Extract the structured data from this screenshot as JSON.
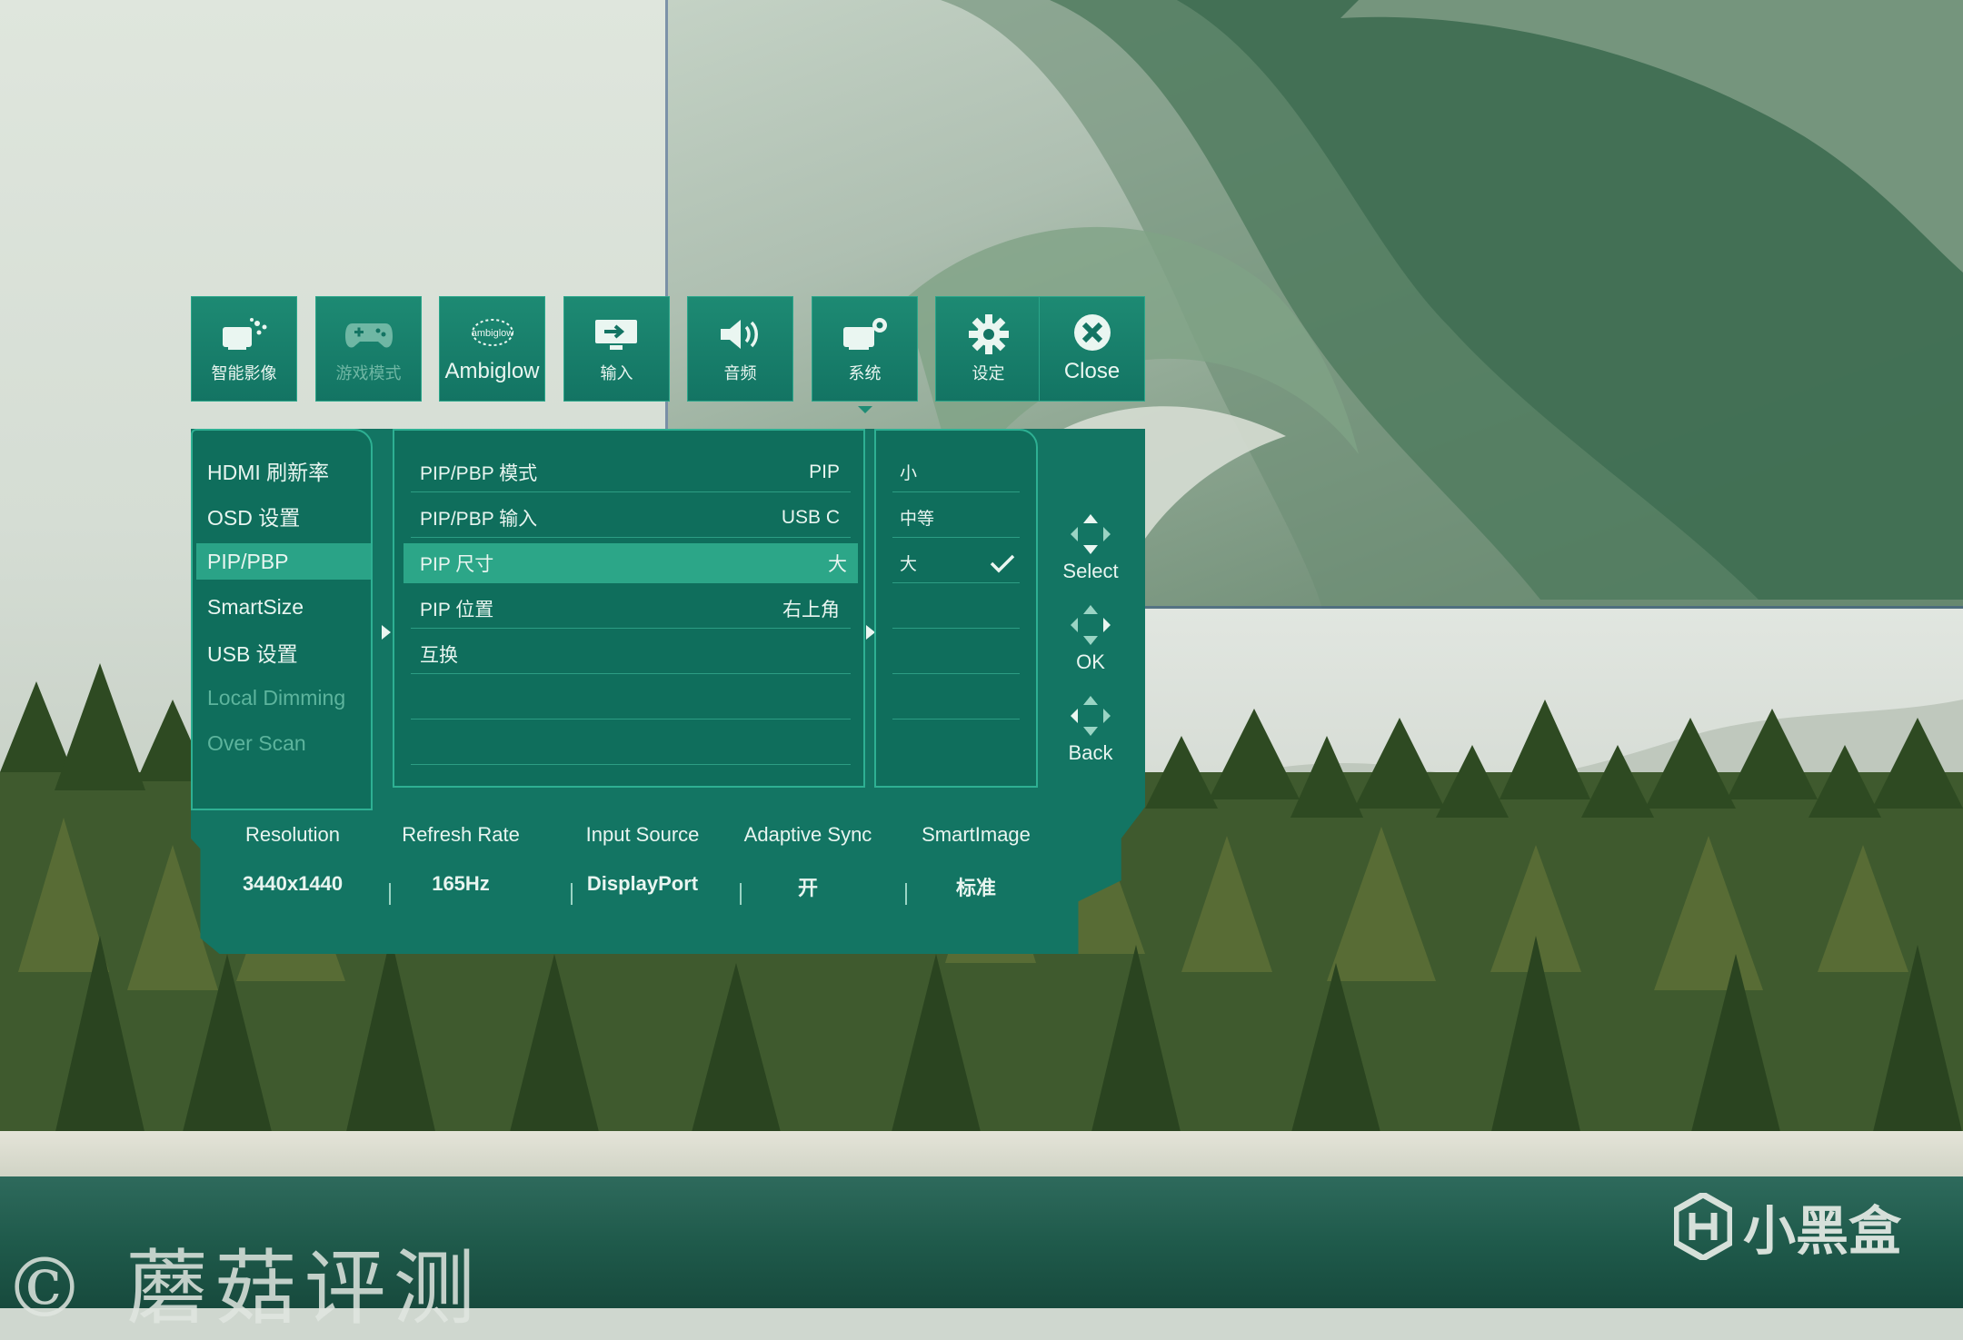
{
  "watermark": {
    "left_text": "© 蘑菇评测",
    "brand_text": "小黑盒"
  },
  "osd": {
    "tabs": [
      {
        "label": "智能影像",
        "icon": "smart-image-icon",
        "dim": false
      },
      {
        "label": "游戏模式",
        "icon": "gamepad-icon",
        "dim": true
      },
      {
        "label": "Ambiglow",
        "icon": "ambiglow-logo-icon",
        "dim": false
      },
      {
        "label": "输入",
        "icon": "input-icon",
        "dim": false
      },
      {
        "label": "音频",
        "icon": "speaker-icon",
        "dim": false
      },
      {
        "label": "系统",
        "icon": "system-icon",
        "dim": false
      },
      {
        "label": "设定",
        "icon": "gear-icon",
        "dim": false
      },
      {
        "label": "Close",
        "icon": "close-icon",
        "dim": false
      }
    ],
    "ambiglow_small": "ambiglow",
    "active_tab_index": 5,
    "left_menu": [
      {
        "label": "HDMI 刷新率",
        "state": "normal"
      },
      {
        "label": "OSD 设置",
        "state": "normal"
      },
      {
        "label": "PIP/PBP",
        "state": "selected"
      },
      {
        "label": "SmartSize",
        "state": "normal"
      },
      {
        "label": "USB 设置",
        "state": "normal"
      },
      {
        "label": "Local Dimming",
        "state": "dim"
      },
      {
        "label": "Over Scan",
        "state": "dim"
      }
    ],
    "mid_menu": [
      {
        "label": "PIP/PBP 模式",
        "value": "PIP"
      },
      {
        "label": "PIP/PBP 输入",
        "value": "USB C"
      },
      {
        "label": "PIP 尺寸",
        "value": "大"
      },
      {
        "label": "PIP 位置",
        "value": "右上角"
      },
      {
        "label": "互换",
        "value": ""
      }
    ],
    "mid_selected_index": 2,
    "right_menu": [
      {
        "label": "小",
        "checked": false
      },
      {
        "label": "中等",
        "checked": false
      },
      {
        "label": "大",
        "checked": true
      }
    ],
    "nav": {
      "select": "Select",
      "ok": "OK",
      "back": "Back"
    },
    "status": {
      "headers": [
        "Resolution",
        "Refresh Rate",
        "Input Source",
        "Adaptive Sync",
        "SmartImage"
      ],
      "values": [
        "3440x1440",
        "165Hz",
        "DisplayPort",
        "开",
        "标准"
      ]
    },
    "colors": {
      "panel": "#137563",
      "highlight": "#2aa387",
      "text": "#e8f5f0"
    }
  }
}
